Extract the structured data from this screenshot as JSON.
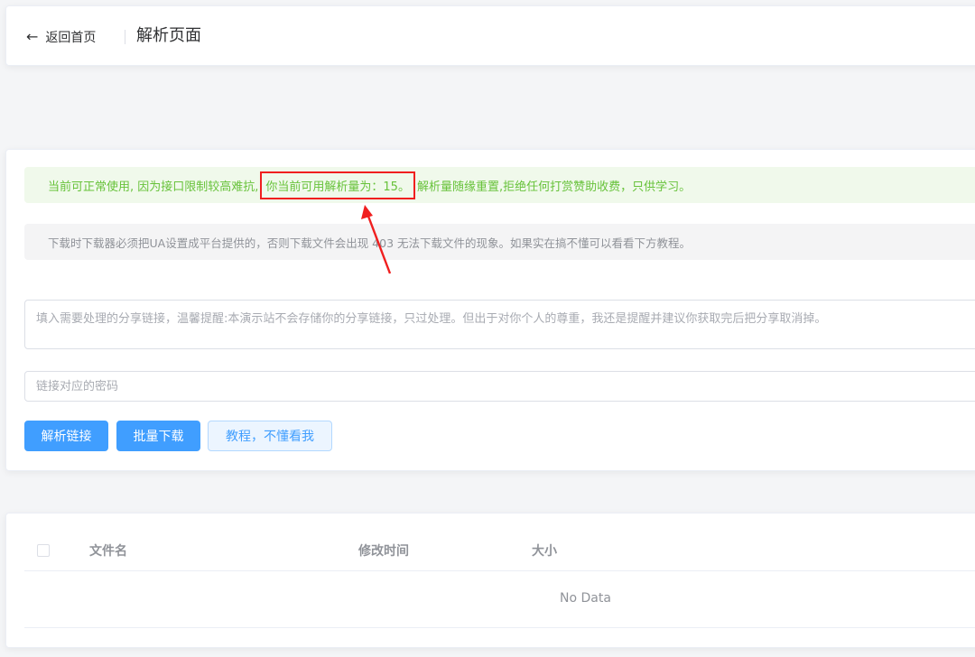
{
  "header": {
    "back_label": "返回首页",
    "title": "解析页面"
  },
  "alerts": {
    "success_before": "当前可正常使用, 因为接口限制较高难抗,",
    "success_highlight": "你当前可用解析量为：15。",
    "success_after": "解析量随缘重置,拒绝任何打赏赞助收费，只供学习。",
    "info": "下载时下载器必须把UA设置成平台提供的，否则下载文件会出现 403 无法下载文件的现象。如果实在搞不懂可以看看下方教程。"
  },
  "form": {
    "link_placeholder": "填入需要处理的分享链接，温馨提醒:本演示站不会存储你的分享链接，只过处理。但出于对你个人的尊重，我还是提醒并建议你获取完后把分享取消掉。",
    "password_placeholder": "链接对应的密码"
  },
  "buttons": {
    "parse": "解析链接",
    "batch": "批量下载",
    "tutorial": "教程，不懂看我"
  },
  "table": {
    "columns": [
      "文件名",
      "修改时间",
      "大小"
    ],
    "empty_text": "No Data"
  },
  "colors": {
    "primary": "#409eff",
    "success": "#67c23a",
    "highlight_border": "#f01f1f"
  },
  "icons": {
    "back": "arrow-left-icon",
    "annotation": "red-arrow-annotation"
  }
}
